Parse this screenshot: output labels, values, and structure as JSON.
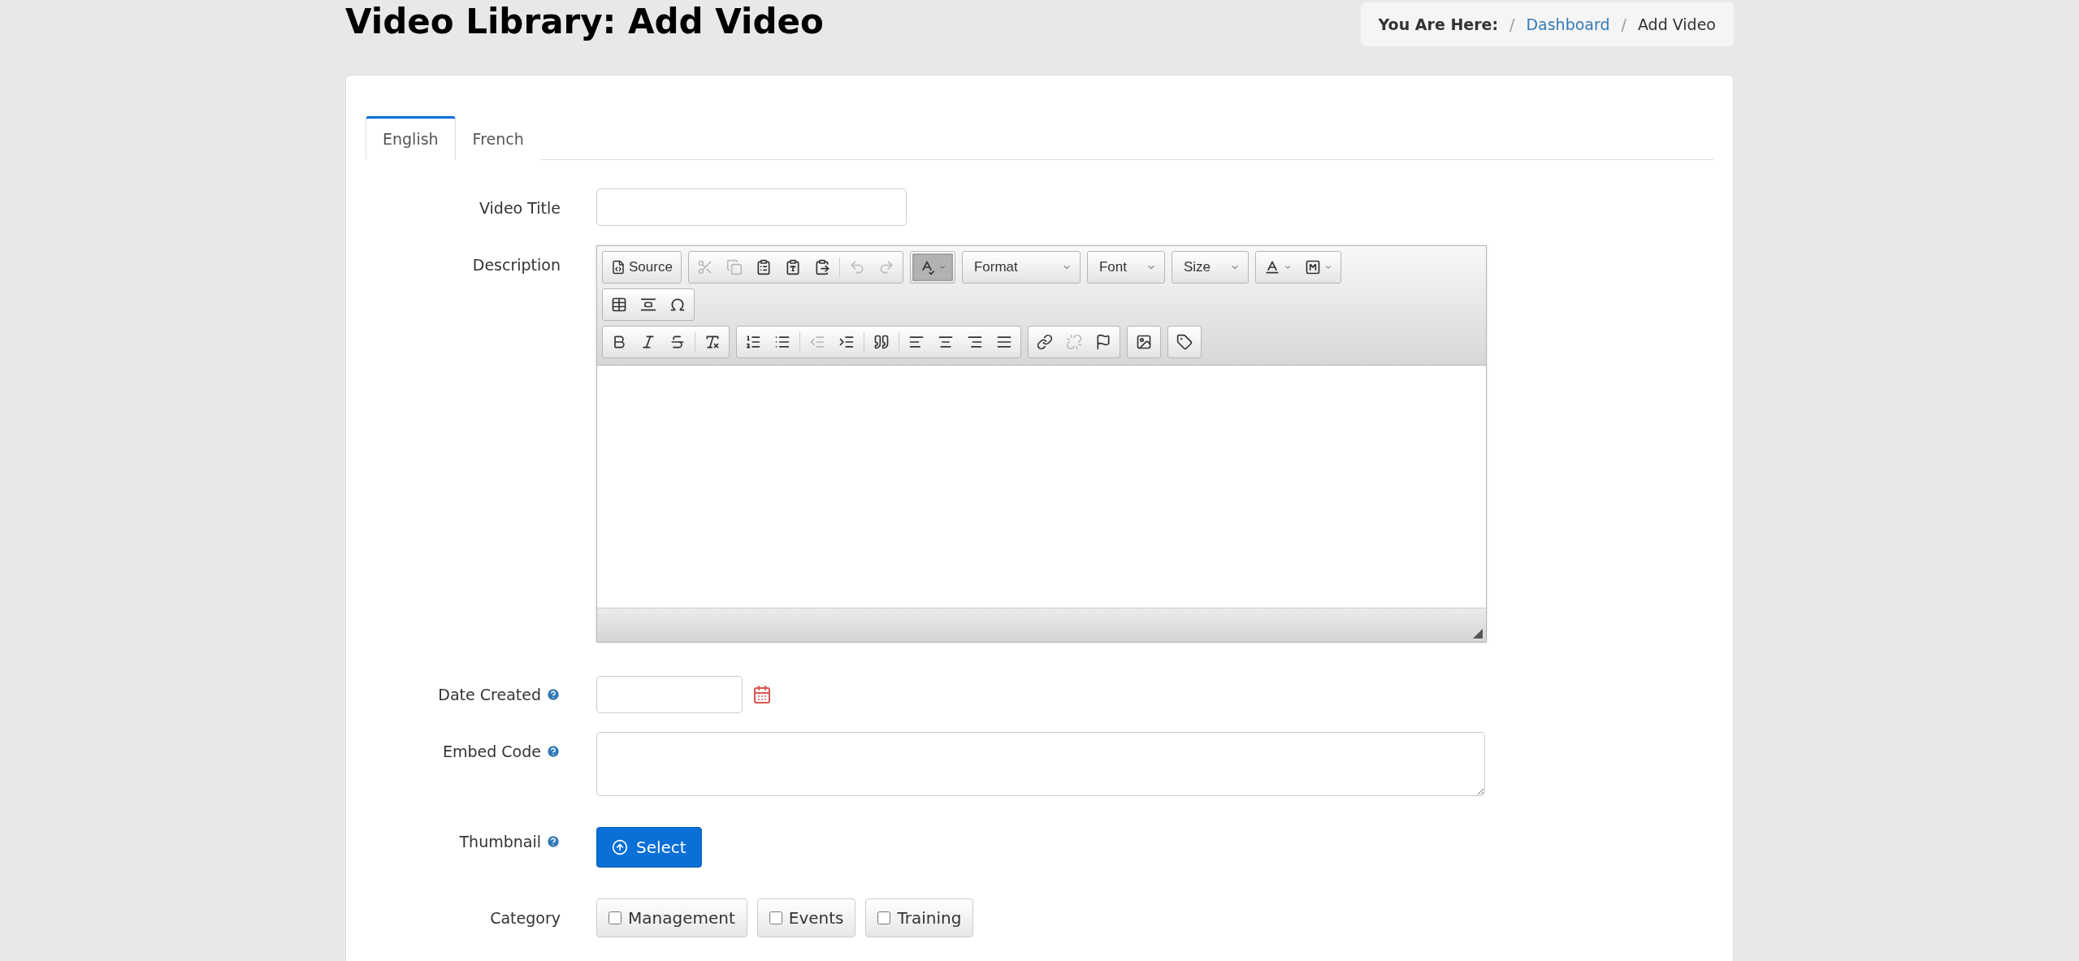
{
  "page_title": "Video Library: Add Video",
  "breadcrumb": {
    "label": "You Are Here:",
    "separator": "/",
    "items": [
      {
        "text": "Dashboard",
        "link": true
      },
      {
        "text": "Add Video",
        "link": false
      }
    ]
  },
  "tabs": [
    {
      "label": "English",
      "selected": true
    },
    {
      "label": "French",
      "selected": false
    }
  ],
  "form": {
    "video_title": {
      "label": "Video Title"
    },
    "description": {
      "label": "Description",
      "toolbar_rows": [
        [
          [
            {
              "kind": "button",
              "label": "Source",
              "disabled": false,
              "active": false
            }
          ],
          [
            {
              "kind": "icon",
              "disabled": true,
              "active": false
            },
            {
              "kind": "icon",
              "disabled": true,
              "active": false
            },
            {
              "kind": "icon",
              "disabled": false,
              "active": false
            },
            {
              "kind": "icon",
              "disabled": false,
              "active": false
            },
            {
              "kind": "icon",
              "disabled": false,
              "active": false
            },
            {
              "kind": "separator"
            },
            {
              "kind": "icon",
              "disabled": true,
              "active": false
            },
            {
              "kind": "icon",
              "disabled": true,
              "active": false
            }
          ],
          [
            {
              "kind": "menu-icon",
              "disabled": false,
              "active": true
            }
          ],
          [
            {
              "kind": "combo",
              "label": "Format"
            }
          ],
          [
            {
              "kind": "combo",
              "label": "Font"
            }
          ],
          [
            {
              "kind": "combo",
              "label": "Size"
            }
          ],
          [
            {
              "kind": "menu-icon",
              "disabled": false,
              "active": false
            },
            {
              "kind": "menu-icon",
              "disabled": false,
              "active": false
            }
          ]
        ],
        [
          [
            {
              "kind": "icon",
              "disabled": false,
              "active": false
            },
            {
              "kind": "icon",
              "disabled": false,
              "active": false
            },
            {
              "kind": "icon",
              "disabled": false,
              "active": false
            }
          ]
        ],
        [
          [
            {
              "kind": "icon",
              "disabled": false,
              "active": false
            },
            {
              "kind": "icon",
              "disabled": false,
              "active": false
            },
            {
              "kind": "icon",
              "disabled": false,
              "active": false
            },
            {
              "kind": "separator"
            },
            {
              "kind": "icon",
              "disabled": false,
              "active": false
            }
          ],
          [
            {
              "kind": "icon",
              "disabled": false,
              "active": false
            },
            {
              "kind": "icon",
              "disabled": false,
              "active": false
            },
            {
              "kind": "separator"
            },
            {
              "kind": "icon",
              "disabled": true,
              "active": false
            },
            {
              "kind": "icon",
              "disabled": false,
              "active": false
            },
            {
              "kind": "separator"
            },
            {
              "kind": "icon",
              "disabled": false,
              "active": false
            },
            {
              "kind": "separator"
            },
            {
              "kind": "icon",
              "disabled": false,
              "active": false
            },
            {
              "kind": "icon",
              "disabled": false,
              "active": false
            },
            {
              "kind": "icon",
              "disabled": false,
              "active": false
            },
            {
              "kind": "icon",
              "disabled": false,
              "active": false
            }
          ],
          [
            {
              "kind": "icon",
              "disabled": false,
              "active": false
            },
            {
              "kind": "icon",
              "disabled": true,
              "active": false
            },
            {
              "kind": "icon",
              "disabled": false,
              "active": false
            }
          ],
          [
            {
              "kind": "icon",
              "disabled": false,
              "active": false
            }
          ],
          [
            {
              "kind": "icon",
              "disabled": false,
              "active": false
            }
          ]
        ]
      ]
    },
    "date_created": {
      "label": "Date Created",
      "help": true
    },
    "embed_code": {
      "label": "Embed Code",
      "help": true
    },
    "thumbnail": {
      "label": "Thumbnail",
      "help": true,
      "button": "Select"
    },
    "category": {
      "label": "Category",
      "options": [
        {
          "label": "Management",
          "checked": false
        },
        {
          "label": "Events",
          "checked": false
        },
        {
          "label": "Training",
          "checked": false
        }
      ]
    }
  }
}
